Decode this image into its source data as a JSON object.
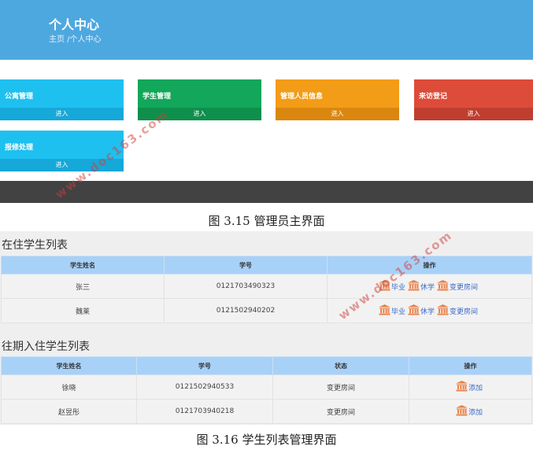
{
  "header": {
    "title": "个人中心",
    "breadcrumb": "主页 /个人中心"
  },
  "tiles": [
    {
      "name": "公寓管理",
      "enter": "进入",
      "color": "#1ec0f0",
      "footer_color": "#16a8d8"
    },
    {
      "name": "学生管理",
      "enter": "进入",
      "color": "#12a75a",
      "footer_color": "#0e8f4c"
    },
    {
      "name": "管理人员信息",
      "enter": "进入",
      "color": "#f39c17",
      "footer_color": "#d9870f"
    },
    {
      "name": "来访登记",
      "enter": "进入",
      "color": "#dd4b39",
      "footer_color": "#bf3e2f"
    },
    {
      "name": "报修处理",
      "enter": "进入",
      "color": "#1ec0f0",
      "footer_color": "#16a8d8"
    }
  ],
  "captions": {
    "fig1": "图 3.15 管理员主界面",
    "fig2": "图 3.16 学生列表管理界面"
  },
  "current_students": {
    "title": "在住学生列表",
    "headers": [
      "学生姓名",
      "学号",
      "操作"
    ],
    "rows": [
      {
        "name": "张三",
        "id": "0121703490323",
        "ops": [
          "毕业",
          "休学",
          "变更房间"
        ]
      },
      {
        "name": "魏莱",
        "id": "0121502940202",
        "ops": [
          "毕业",
          "休学",
          "变更房间"
        ]
      }
    ]
  },
  "past_students": {
    "title": "往期入住学生列表",
    "headers": [
      "学生姓名",
      "学号",
      "状态",
      "操作"
    ],
    "rows": [
      {
        "name": "徐晓",
        "id": "0121502940533",
        "status": "变更房间",
        "op": "添加"
      },
      {
        "name": "赵昱彤",
        "id": "0121703940218",
        "status": "变更房间",
        "op": "添加"
      }
    ]
  },
  "watermark": "www.doc163.com",
  "icons": {
    "op_icon": "bank-icon",
    "op_icon_color": "#e8834a"
  }
}
